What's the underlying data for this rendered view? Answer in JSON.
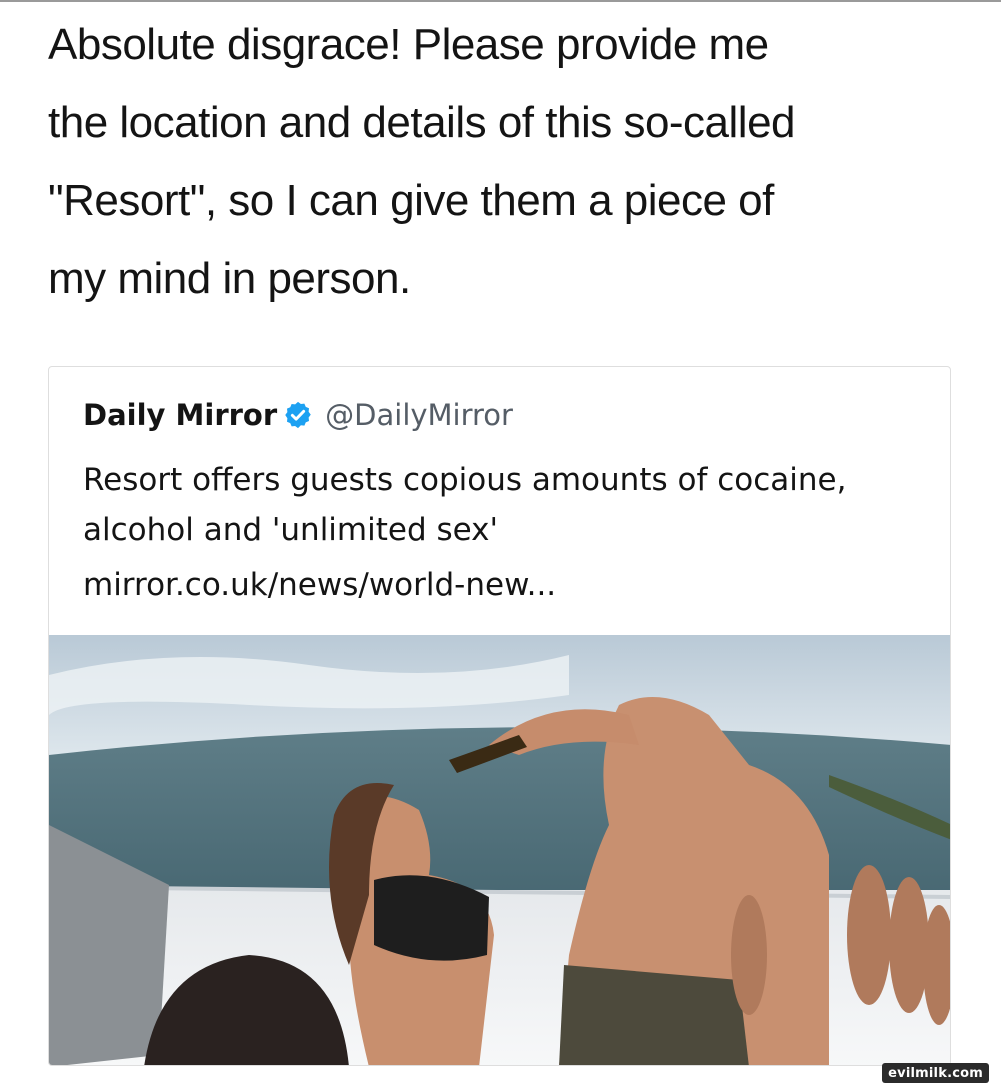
{
  "tweet": {
    "text": "Absolute disgrace! Please provide me\nthe location and details of this so-called\n\"Resort\", so I can give them a piece of\nmy mind in person."
  },
  "quoted_tweet": {
    "display_name": "Daily Mirror",
    "verified_icon": "verified-badge-icon",
    "handle": "@DailyMirror",
    "text": "Resort offers guests copious amounts of cocaine, alcohol and 'unlimited sex'",
    "link": "mirror.co.uk/news/world-new...",
    "accent_color": "#1da1f2"
  },
  "watermark": {
    "text": "evilmilk.com"
  }
}
